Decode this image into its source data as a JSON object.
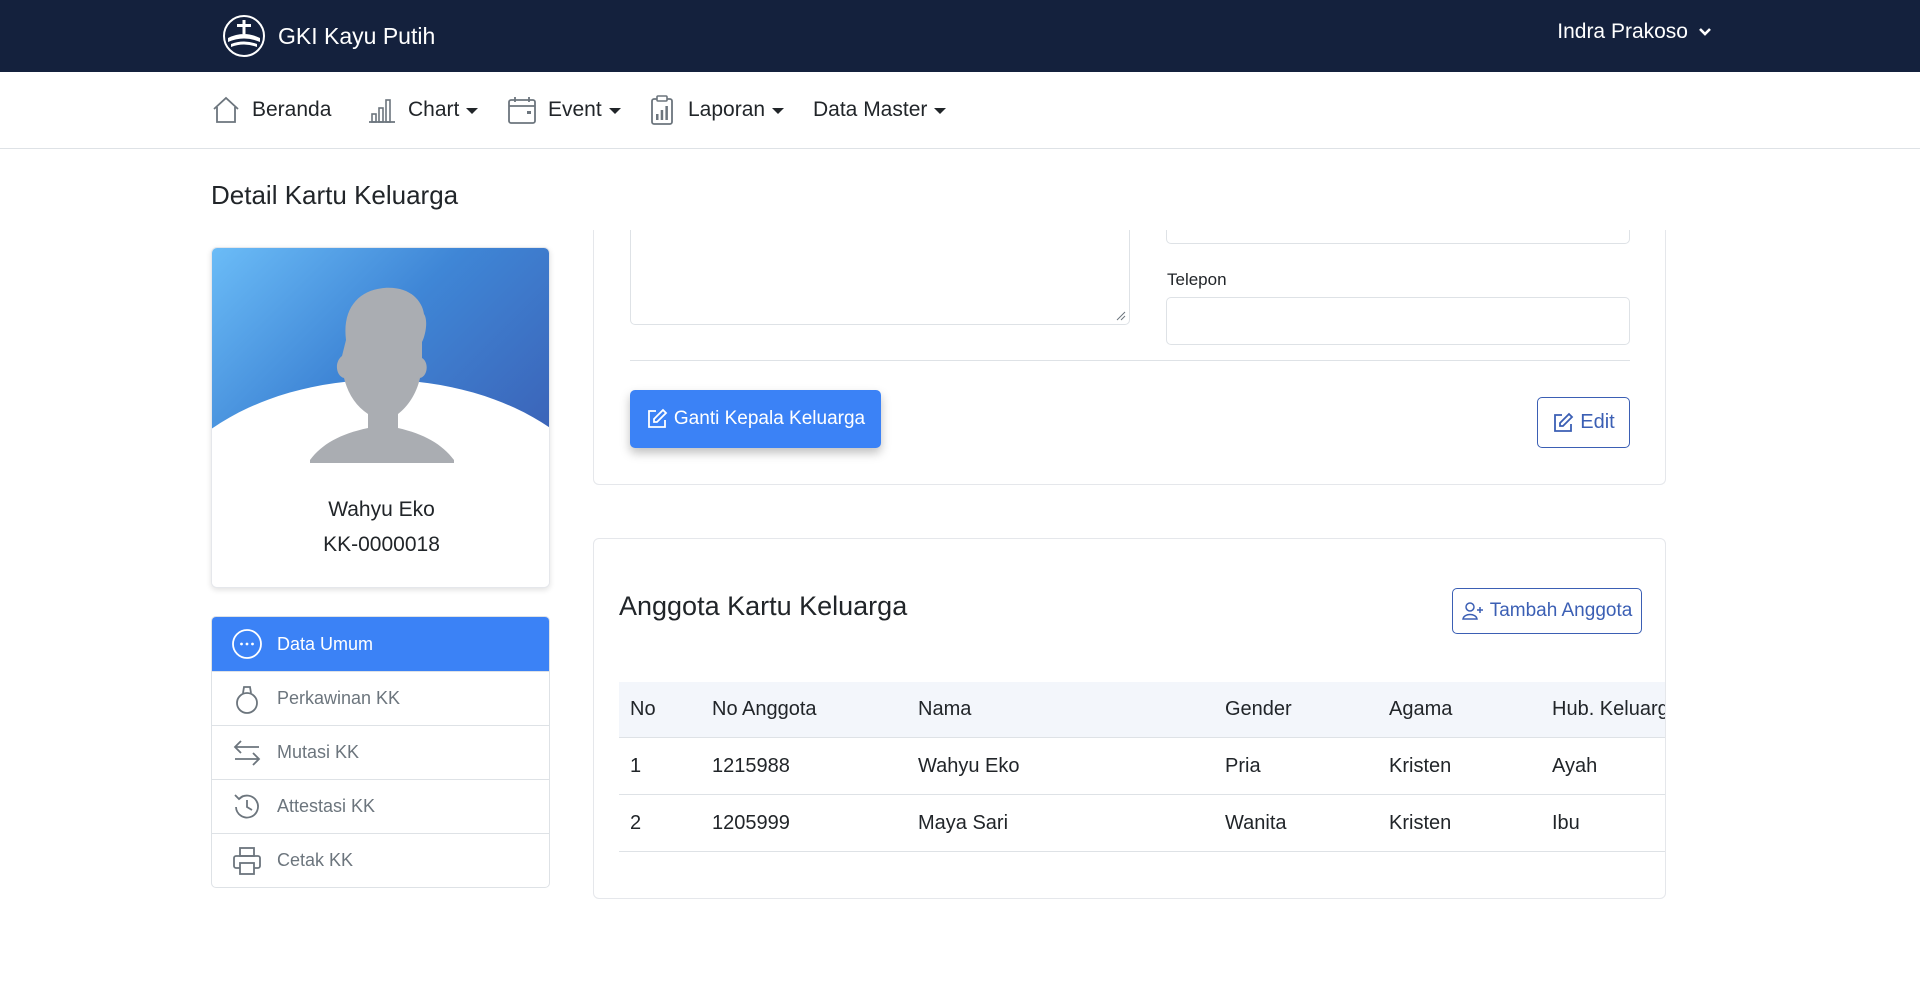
{
  "header": {
    "brand": "GKI Kayu Putih",
    "user_name": "Indra Prakoso"
  },
  "nav": {
    "items": [
      {
        "label": "Beranda",
        "icon": "home-icon"
      },
      {
        "label": "Chart",
        "icon": "bar-chart-icon"
      },
      {
        "label": "Event",
        "icon": "calendar-icon"
      },
      {
        "label": "Laporan",
        "icon": "clipboard-chart-icon"
      },
      {
        "label": "Data Master"
      }
    ]
  },
  "page": {
    "title": "Detail Kartu Keluarga"
  },
  "profile": {
    "name": "Wahyu Eko",
    "kk_number": "KK-0000018"
  },
  "side_menu": {
    "items": [
      {
        "label": "Data Umum",
        "icon": "dots-circle-icon",
        "active": true
      },
      {
        "label": "Perkawinan KK",
        "icon": "ring-icon"
      },
      {
        "label": "Mutasi KK",
        "icon": "arrows-swap-icon"
      },
      {
        "label": "Attestasi KK",
        "icon": "history-icon"
      },
      {
        "label": "Cetak KK",
        "icon": "printer-icon"
      }
    ]
  },
  "form": {
    "telepon_label": "Telepon",
    "telepon_value": "",
    "ganti_button": "Ganti Kepala Keluarga",
    "edit_button": "Edit"
  },
  "members": {
    "title": "Anggota Kartu Keluarga",
    "add_button": "Tambah Anggota",
    "columns": [
      "No",
      "No Anggota",
      "Nama",
      "Gender",
      "Agama",
      "Hub. Keluarga"
    ],
    "rows": [
      [
        "1",
        "1215988",
        "Wahyu Eko",
        "Pria",
        "Kristen",
        "Ayah"
      ],
      [
        "2",
        "1205999",
        "Maya Sari",
        "Wanita",
        "Kristen",
        "Ibu"
      ]
    ]
  },
  "colors": {
    "topbar": "#14213d",
    "primary": "#3b82f6",
    "outline": "#3b5fb4"
  }
}
